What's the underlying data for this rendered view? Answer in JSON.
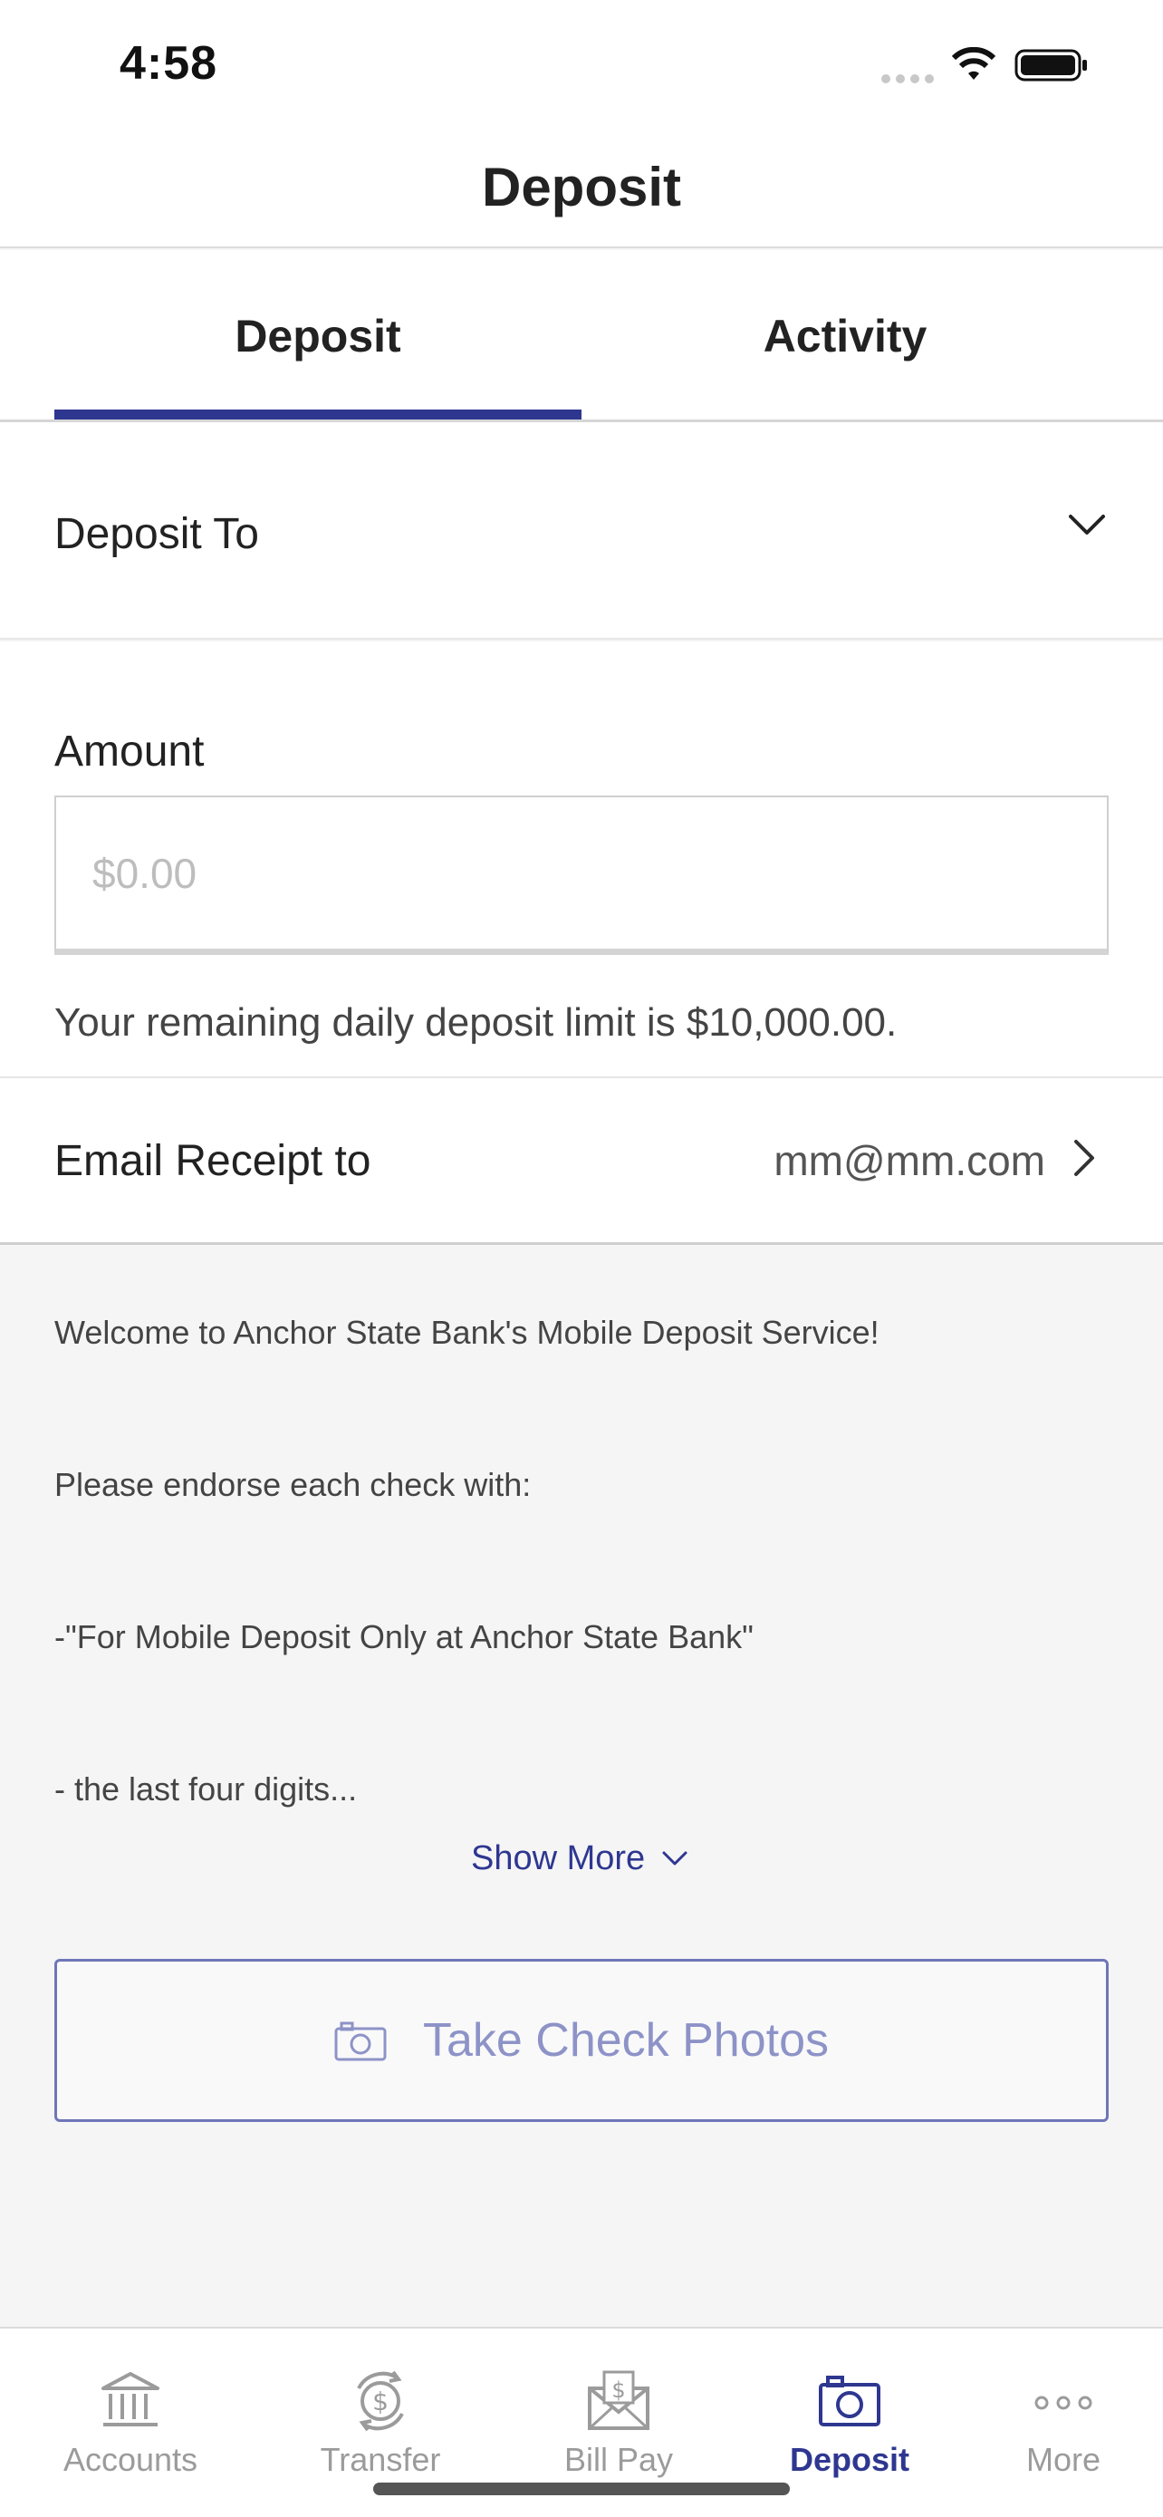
{
  "status_bar": {
    "time": "4:58"
  },
  "header": {
    "title": "Deposit"
  },
  "tabs": [
    {
      "label": "Deposit",
      "active": true
    },
    {
      "label": "Activity",
      "active": false
    }
  ],
  "deposit_to": {
    "label": "Deposit To"
  },
  "amount": {
    "label": "Amount",
    "placeholder": "$0.00",
    "limit_text": "Your remaining daily deposit limit is $10,000.00."
  },
  "email_receipt": {
    "label": "Email Receipt to",
    "value": "mm@mm.com"
  },
  "instructions": {
    "lines": [
      "Welcome to Anchor State Bank's Mobile Deposit Service!",
      "Please endorse each check with:",
      "-\"For Mobile Deposit Only at Anchor State Bank\"",
      "- the last four digits..."
    ],
    "show_more_label": "Show More"
  },
  "take_photos_button": {
    "label": "Take Check Photos"
  },
  "bottom_nav": [
    {
      "label": "Accounts",
      "icon": "bank-icon",
      "active": false
    },
    {
      "label": "Transfer",
      "icon": "transfer-icon",
      "active": false
    },
    {
      "label": "Bill Pay",
      "icon": "bill-pay-icon",
      "active": false
    },
    {
      "label": "Deposit",
      "icon": "camera-icon",
      "active": true
    },
    {
      "label": "More",
      "icon": "more-dots-icon",
      "active": false
    }
  ],
  "colors": {
    "accent": "#2e3790",
    "button_text": "#8d93c7",
    "inactive_nav": "#9b9b9b",
    "background": "#f5f5f6"
  }
}
